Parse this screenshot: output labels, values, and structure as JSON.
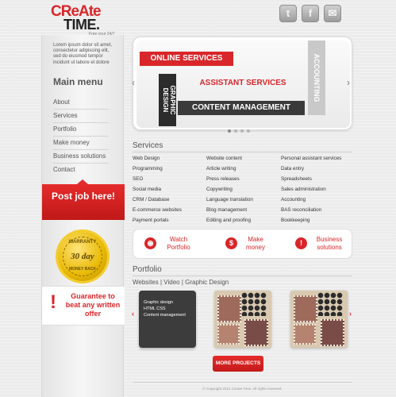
{
  "logo": {
    "top": "CReAte",
    "bottom": "TIME.",
    "tagline": "Free your 24/7"
  },
  "social": [
    {
      "name": "twitter-icon",
      "glyph": "t"
    },
    {
      "name": "facebook-icon",
      "glyph": "f"
    },
    {
      "name": "email-icon",
      "glyph": "✉"
    }
  ],
  "sidebar": {
    "intro": "Lorem ipsum dolor sit amet, consectetur adipiscing elit, sed do eiusmod tempor incidunt ut labore et dolore",
    "menu_title": "Main menu",
    "items": [
      "About",
      "Services",
      "Portfolio",
      "Make money",
      "Business solutions",
      "Contact"
    ],
    "post_job": "Post job here!",
    "warranty": {
      "top": "WARRANTY",
      "middle": "30 day",
      "bottom": "MONEY BACK"
    },
    "guarantee_icon": "!",
    "guarantee": "Guarantee to beat any written offer"
  },
  "slider": {
    "online": "ONLINE SERVICES",
    "assistant": "ASSISTANT SERVICES",
    "graphic": "GRAPHIC DESIGN",
    "content": "CONTENT MANAGEMENT",
    "accounting": "ACCOUNTING",
    "prev": "‹",
    "next": "›"
  },
  "services": {
    "title": "Services",
    "columns": [
      [
        "Web Design",
        "Programming",
        "SEO",
        "Social media",
        "CRM / Database",
        "E-commerce websites",
        "Payment portals"
      ],
      [
        "Website content",
        "Article writing",
        "Press releases",
        "Copywriting",
        "Language translation",
        "Blog management",
        "Editing and proofing"
      ],
      [
        "Personal assistant services",
        "Data entry",
        "Spreadsheets",
        "Sales administration",
        "Accounting",
        "BAS reconciliation",
        "Bookkeeping"
      ]
    ]
  },
  "actions": [
    {
      "icon": "eye-icon",
      "glyph": "◉",
      "label": "Watch Portfolio"
    },
    {
      "icon": "dollar-icon",
      "glyph": "$",
      "label": "Make money"
    },
    {
      "icon": "lightbulb-icon",
      "glyph": "!",
      "label": "Business solutions"
    }
  ],
  "portfolio": {
    "title": "Portfolio",
    "subtitle": "Websites | Video | Graphic Design",
    "card_lines": [
      "Graphic design",
      "HTML CSS",
      "Content management"
    ],
    "prev": "‹",
    "next": "›",
    "more": "MORE PROJECTS"
  },
  "footer": "© Copyright 2012 Create Time. All rights reserved.",
  "colors": {
    "accent": "#d8262a",
    "dark": "#3a3a3a",
    "background": "#ececec"
  }
}
